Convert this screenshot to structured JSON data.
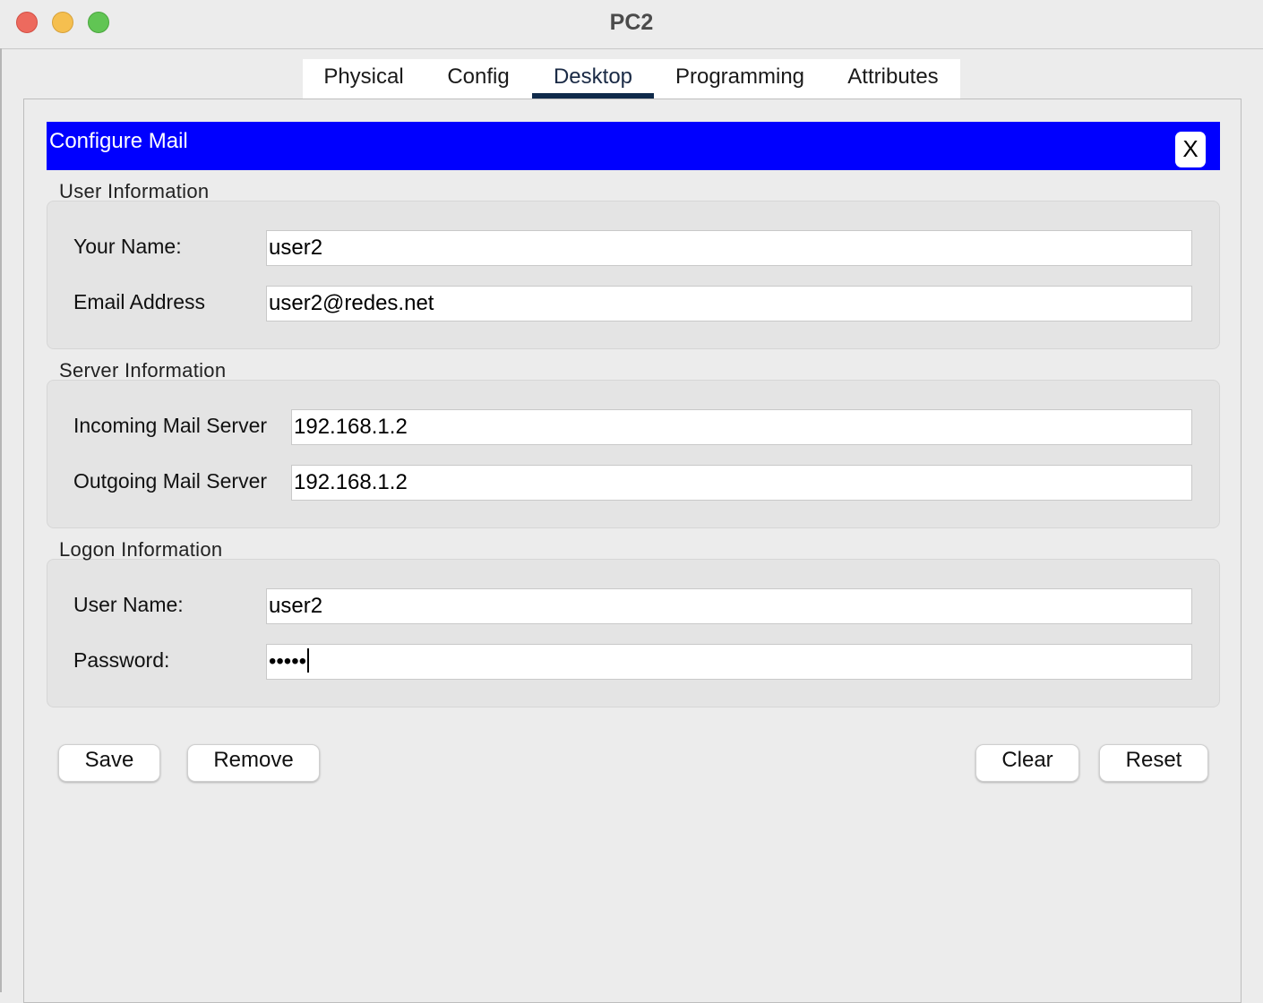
{
  "window": {
    "title": "PC2"
  },
  "tabs": [
    {
      "label": "Physical"
    },
    {
      "label": "Config"
    },
    {
      "label": "Desktop",
      "active": true
    },
    {
      "label": "Programming"
    },
    {
      "label": "Attributes"
    }
  ],
  "config_mail": {
    "title": "Configure Mail",
    "close_label": "X",
    "user_info": {
      "heading": "User Information",
      "name_label": "Your Name:",
      "name_value": "user2",
      "email_label": "Email Address",
      "email_value": "user2@redes.net"
    },
    "server_info": {
      "heading": "Server Information",
      "incoming_label": "Incoming Mail Server",
      "incoming_value": "192.168.1.2",
      "outgoing_label": "Outgoing Mail Server",
      "outgoing_value": "192.168.1.2"
    },
    "logon_info": {
      "heading": "Logon Information",
      "username_label": "User Name:",
      "username_value": "user2",
      "password_label": "Password:",
      "password_value": "•••••"
    },
    "buttons": {
      "save": "Save",
      "remove": "Remove",
      "clear": "Clear",
      "reset": "Reset"
    }
  },
  "colors": {
    "header_blue": "#0000ff",
    "tab_indicator": "#0f2a4a",
    "close_light": "#ed6a5e",
    "minimize_light": "#f5bf4f",
    "maximize_light": "#61c554"
  }
}
